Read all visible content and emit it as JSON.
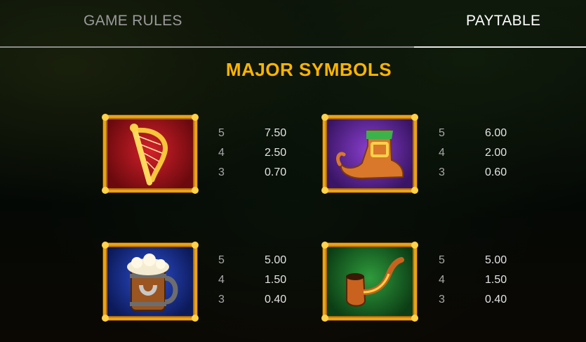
{
  "tabs": {
    "rules": "GAME RULES",
    "paytable": "PAYTABLE"
  },
  "section_title": "MAJOR SYMBOLS",
  "symbols": [
    {
      "icon": "harp-icon",
      "payouts": [
        {
          "count": "5",
          "value": "7.50"
        },
        {
          "count": "4",
          "value": "2.50"
        },
        {
          "count": "3",
          "value": "0.70"
        }
      ]
    },
    {
      "icon": "boot-icon",
      "payouts": [
        {
          "count": "5",
          "value": "6.00"
        },
        {
          "count": "4",
          "value": "2.00"
        },
        {
          "count": "3",
          "value": "0.60"
        }
      ]
    },
    {
      "icon": "beer-mug-icon",
      "payouts": [
        {
          "count": "5",
          "value": "5.00"
        },
        {
          "count": "4",
          "value": "1.50"
        },
        {
          "count": "3",
          "value": "0.40"
        }
      ]
    },
    {
      "icon": "pipe-icon",
      "payouts": [
        {
          "count": "5",
          "value": "5.00"
        },
        {
          "count": "4",
          "value": "1.50"
        },
        {
          "count": "3",
          "value": "0.40"
        }
      ]
    }
  ],
  "colors": {
    "accent": "#ffb400",
    "frame": "#e9a317"
  }
}
